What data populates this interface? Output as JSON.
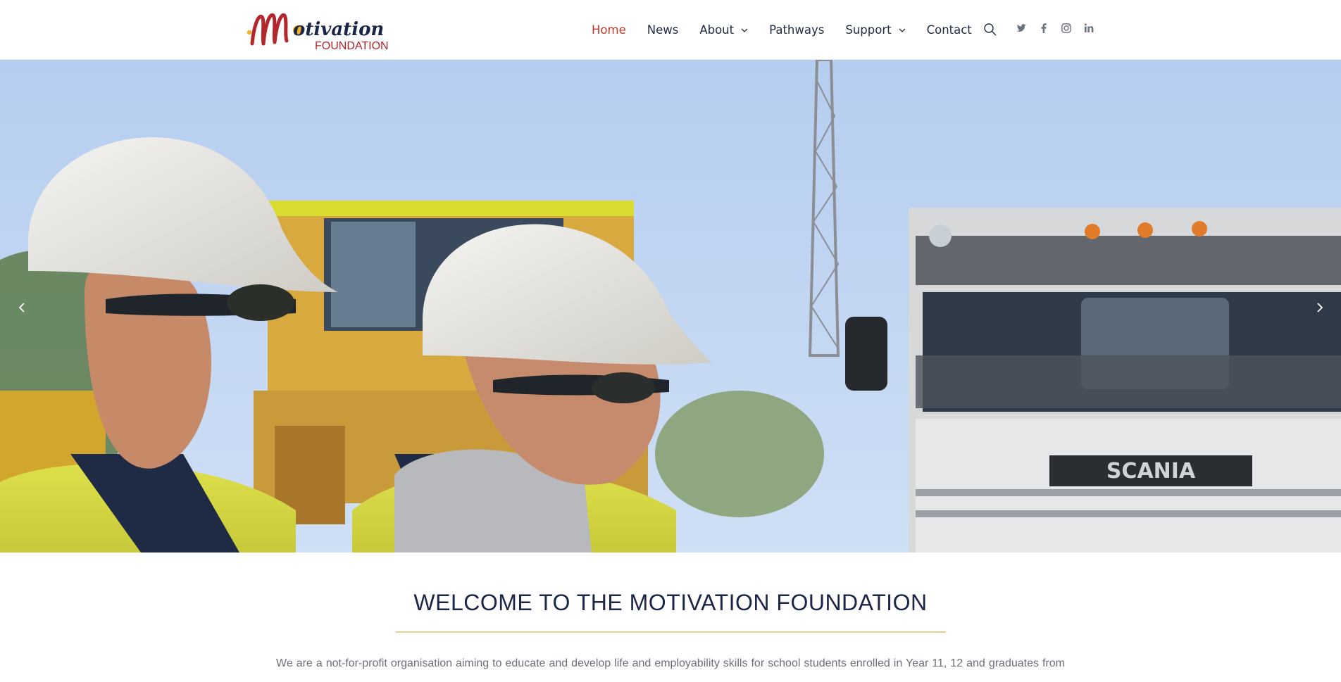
{
  "brand": {
    "logo_word": "otivation",
    "logo_initial": "M",
    "logo_sub": "FOUNDATION"
  },
  "nav": {
    "items": [
      {
        "label": "Home",
        "active": true,
        "has_dropdown": false
      },
      {
        "label": "News",
        "active": false,
        "has_dropdown": false
      },
      {
        "label": "About",
        "active": false,
        "has_dropdown": true
      },
      {
        "label": "Pathways",
        "active": false,
        "has_dropdown": false
      },
      {
        "label": "Support",
        "active": false,
        "has_dropdown": true
      },
      {
        "label": "Contact",
        "active": false,
        "has_dropdown": false
      }
    ],
    "search_icon": "search-icon",
    "socials": [
      "twitter-icon",
      "facebook-icon",
      "instagram-icon",
      "linkedin-icon"
    ]
  },
  "hero": {
    "truck_badge": "SCANIA",
    "prev_icon": "chevron-left-icon",
    "next_icon": "chevron-right-icon"
  },
  "welcome": {
    "title": "WELCOME TO THE MOTIVATION FOUNDATION",
    "text": "We are a not-for-profit organisation aiming to educate and develop life and employability skills for school students enrolled in Year 11, 12 and graduates from"
  },
  "colors": {
    "navy": "#1f2a44",
    "active": "#c0392b",
    "accent_rule": "#e7cf8c",
    "logo_red": "#b3262c",
    "logo_gold": "#f0b323"
  }
}
